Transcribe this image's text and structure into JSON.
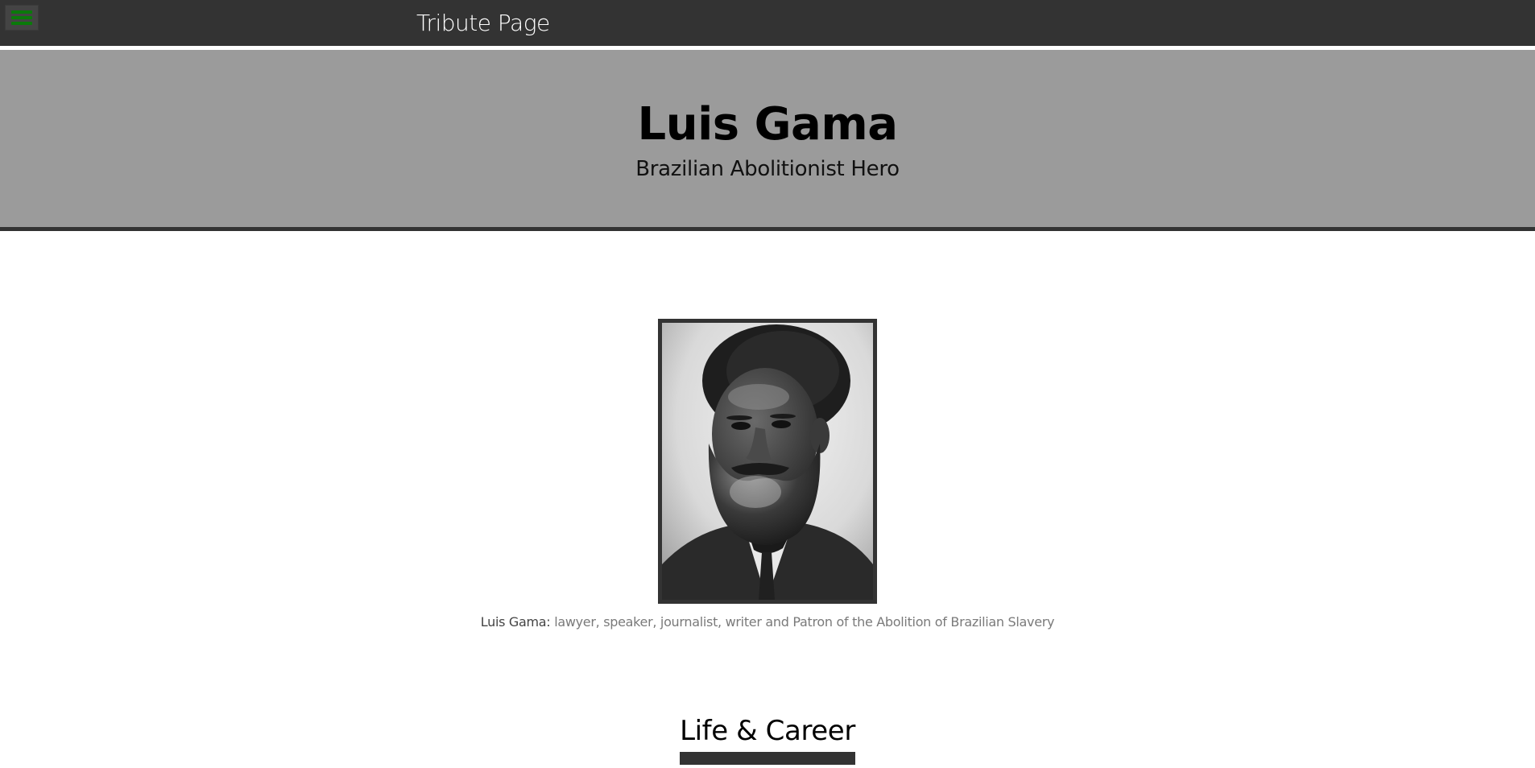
{
  "header": {
    "menu_icon": "hamburger-menu-icon",
    "brand": "Tribute Page",
    "accent_color": "#0a7a0a",
    "bar_color": "#333333"
  },
  "hero": {
    "title": "Luis Gama",
    "subtitle": "Brazilian Abolitionist Hero",
    "background_color": "#9b9b9b"
  },
  "portrait": {
    "alt": "Portrait of Luis Gama"
  },
  "caption": {
    "name": "Luis Gama:",
    "text": " lawyer, speaker, journalist, writer and Patron of the Abolition of Brazilian Slavery"
  },
  "sections": [
    {
      "title": "Life & Career"
    }
  ]
}
